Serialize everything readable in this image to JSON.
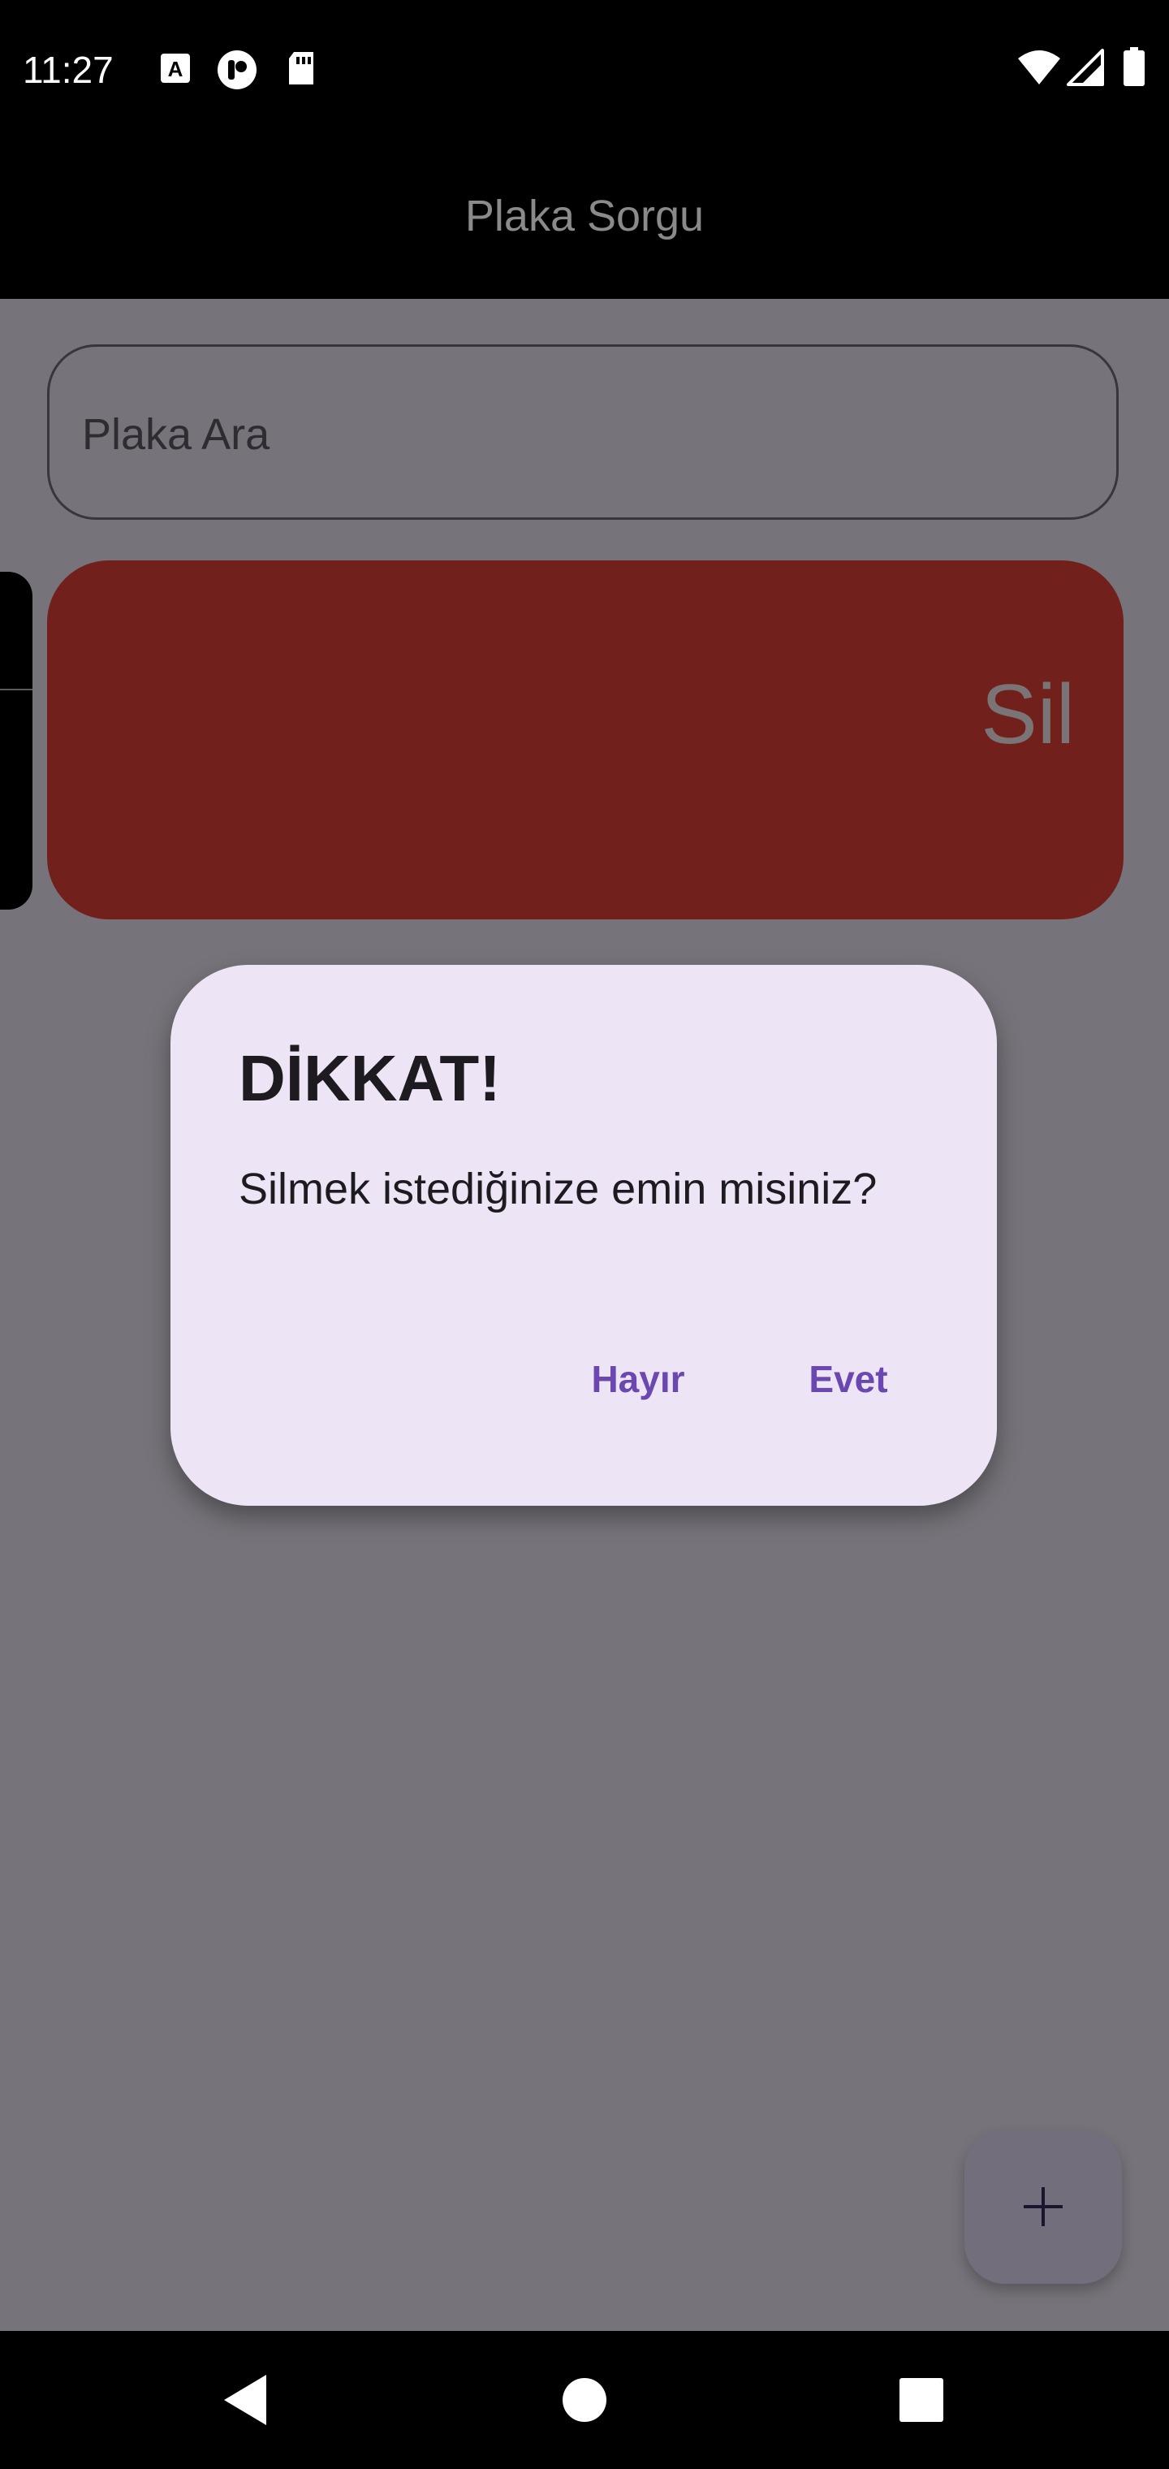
{
  "status_bar": {
    "time": "11:27",
    "left_icons": [
      "a-font-icon",
      "app-notification-icon",
      "sd-card-icon"
    ],
    "right_icons": [
      "wifi-icon",
      "signal-icon",
      "battery-icon"
    ]
  },
  "app_bar": {
    "title": "Plaka Sorgu"
  },
  "search": {
    "placeholder": "Plaka Ara"
  },
  "list_item": {
    "delete_label": "Sil",
    "delete_color": "#72201c"
  },
  "dialog": {
    "title": "DİKKAT!",
    "message": "Silmek istediğinize emin misiniz?",
    "no_label": "Hayır",
    "yes_label": "Evet",
    "accent_color": "#6b48b0"
  },
  "fab": {
    "icon": "plus-icon"
  },
  "nav_bar": {
    "icons": [
      "back-icon",
      "home-icon",
      "recents-icon"
    ]
  }
}
